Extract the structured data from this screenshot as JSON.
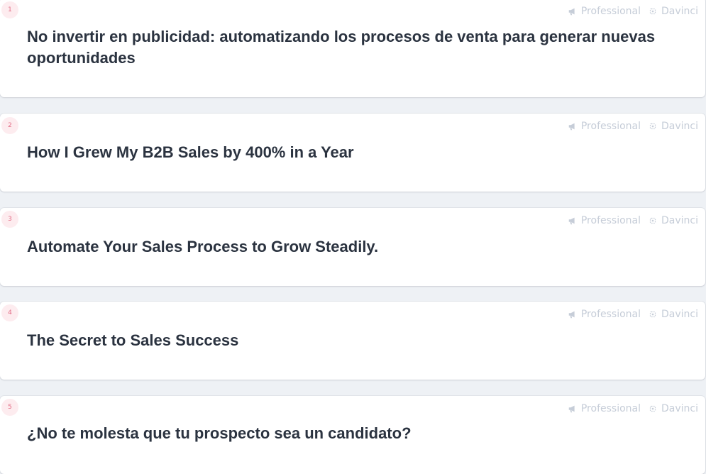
{
  "colors": {
    "background": "#eef1f5",
    "card": "#ffffff",
    "badge_bg": "#fdecef",
    "badge_text": "#e26d86",
    "meta_text": "#c6cdd8",
    "title_text": "#2b3340"
  },
  "items": [
    {
      "number": "1",
      "title": "No invertir en publicidad: automatizando los procesos de venta para generar nuevas oportunidades",
      "tone": "Professional",
      "tone_icon": "megaphone-icon",
      "model": "Davinci",
      "model_icon": "ai-chip-icon"
    },
    {
      "number": "2",
      "title": "How I Grew My B2B Sales by 400% in a Year",
      "tone": "Professional",
      "tone_icon": "megaphone-icon",
      "model": "Davinci",
      "model_icon": "ai-chip-icon"
    },
    {
      "number": "3",
      "title": "Automate Your Sales Process to Grow Steadily.",
      "tone": "Professional",
      "tone_icon": "megaphone-icon",
      "model": "Davinci",
      "model_icon": "ai-chip-icon"
    },
    {
      "number": "4",
      "title": "The Secret to Sales Success",
      "tone": "Professional",
      "tone_icon": "megaphone-icon",
      "model": "Davinci",
      "model_icon": "ai-chip-icon"
    },
    {
      "number": "5",
      "title": "¿No te molesta que tu prospecto sea un candidato?",
      "tone": "Professional",
      "tone_icon": "megaphone-icon",
      "model": "Davinci",
      "model_icon": "ai-chip-icon"
    }
  ]
}
